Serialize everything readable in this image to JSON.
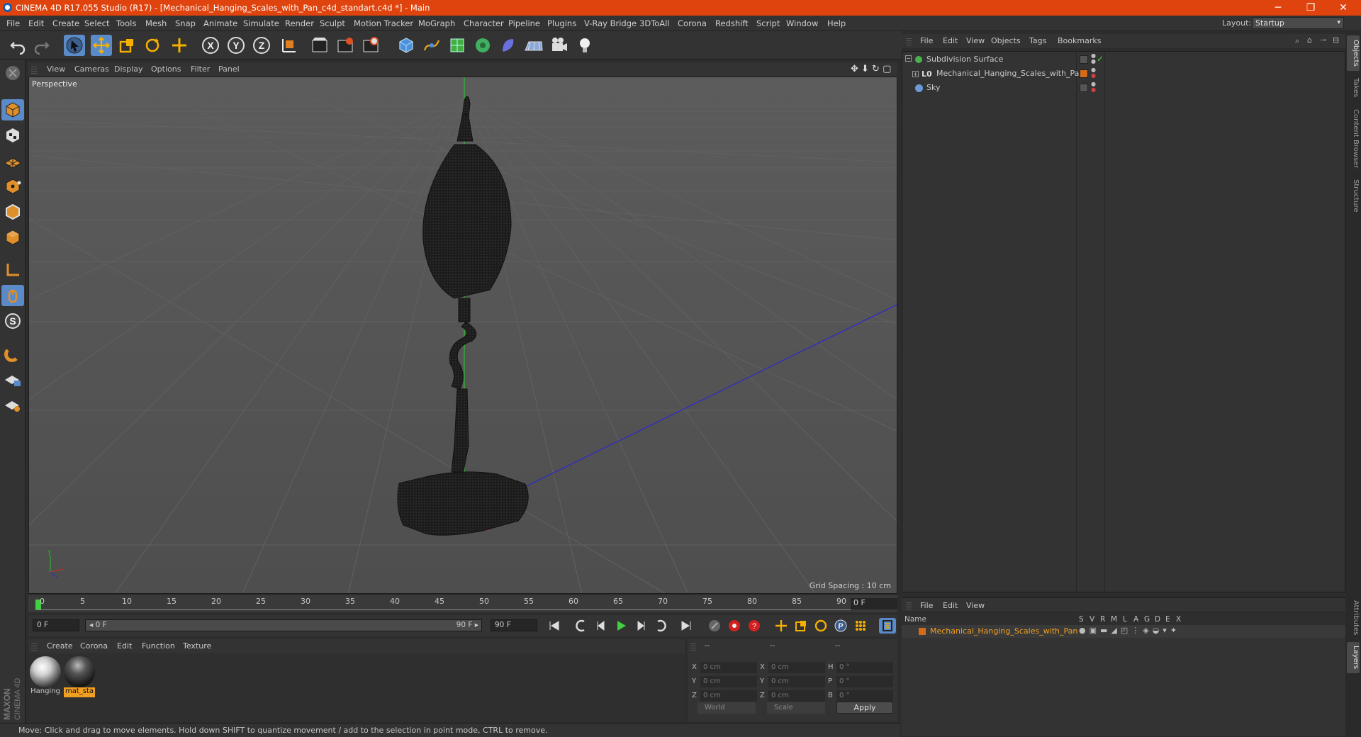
{
  "window": {
    "title": "CINEMA 4D R17.055 Studio (R17) - [Mechanical_Hanging_Scales_with_Pan_c4d_standart.c4d *] - Main",
    "minimize": "─",
    "maximize": "❐",
    "close": "✕"
  },
  "menubar": {
    "items": [
      "File",
      "Edit",
      "Create",
      "Select",
      "Tools",
      "Mesh",
      "Snap",
      "Animate",
      "Simulate",
      "Render",
      "Sculpt",
      "Motion Tracker",
      "MoGraph",
      "Character",
      "Pipeline",
      "Plugins",
      "V-Ray Bridge",
      "3DToAll",
      "Corona",
      "Redshift",
      "Script",
      "Window",
      "Help"
    ],
    "layout_label": "Layout:",
    "layout_value": "Startup"
  },
  "toolbar": {
    "icons": [
      "undo-icon",
      "redo-icon",
      "select-arrow-icon",
      "move-icon",
      "scale-icon",
      "rotate-icon",
      "live-select-icon",
      "x-axis-icon",
      "y-axis-icon",
      "z-axis-icon",
      "coordinate-system-icon",
      "render-view-icon",
      "render-picture-viewer-icon",
      "edit-render-settings-icon",
      "cube-primitive-icon",
      "spline-pen-icon",
      "subdivision-surface-icon",
      "cloner-icon",
      "deformer-icon",
      "floor-icon",
      "camera-icon",
      "light-icon"
    ]
  },
  "viewport": {
    "menu": [
      "View",
      "Cameras",
      "Display",
      "Options",
      "Filter",
      "Panel"
    ],
    "label": "Perspective",
    "grid_spacing": "Grid Spacing : 10 cm"
  },
  "timeline": {
    "ticks": [
      "0",
      "5",
      "10",
      "15",
      "20",
      "25",
      "30",
      "35",
      "40",
      "45",
      "50",
      "55",
      "60",
      "65",
      "70",
      "75",
      "80",
      "85",
      "90"
    ],
    "current_frame": "0 F",
    "start_field": "0 F",
    "range_start": "◂ 0 F",
    "range_end": "90 F ▸",
    "end_field": "90 F"
  },
  "materials": {
    "menu": [
      "Create",
      "Corona",
      "Edit",
      "Function",
      "Texture"
    ],
    "items": [
      {
        "label": "Hanging",
        "selected": false
      },
      {
        "label": "mat_sta",
        "selected": true
      }
    ]
  },
  "coordinates": {
    "header": [
      "--",
      "--",
      "--"
    ],
    "pos_labels": [
      "X",
      "Y",
      "Z"
    ],
    "size_labels": [
      "X",
      "Y",
      "Z"
    ],
    "rot_labels": [
      "H",
      "P",
      "B"
    ],
    "pos_values": [
      "0 cm",
      "0 cm",
      "0 cm"
    ],
    "size_values": [
      "0 cm",
      "0 cm",
      "0 cm"
    ],
    "rot_values": [
      "0 °",
      "0 °",
      "0 °"
    ],
    "mode_world": "World",
    "mode_scale": "Scale",
    "apply": "Apply"
  },
  "status": {
    "text": "Move: Click and drag to move elements. Hold down SHIFT to quantize movement / add to the selection in point mode, CTRL to remove."
  },
  "objects_panel": {
    "menu": [
      "File",
      "Edit",
      "View",
      "Objects",
      "Tags",
      "Bookmarks"
    ],
    "rows": [
      {
        "name": "Subdivision Surface",
        "color": "#4cb04c"
      },
      {
        "name": "Mechanical_Hanging_Scales_with_Pan",
        "color": "#d46a1a"
      },
      {
        "name": "Sky",
        "color": "#6a9ad8"
      }
    ]
  },
  "layers_panel": {
    "menu": [
      "File",
      "Edit",
      "View"
    ],
    "header_name": "Name",
    "columns": [
      "S",
      "V",
      "R",
      "M",
      "L",
      "A",
      "G",
      "D",
      "E",
      "X"
    ],
    "row_name": "Mechanical_Hanging_Scales_with_Pan"
  },
  "side_tabs": [
    "Objects",
    "Takes",
    "Content Browser",
    "Structure"
  ],
  "side_tabs_bottom": [
    "Attributes",
    "Layers"
  ],
  "branding": "MAXON CINEMA 4D",
  "colors": {
    "accent": "#e0440e",
    "selection": "#5a8ac8",
    "layer_highlight": "#f0a020"
  }
}
